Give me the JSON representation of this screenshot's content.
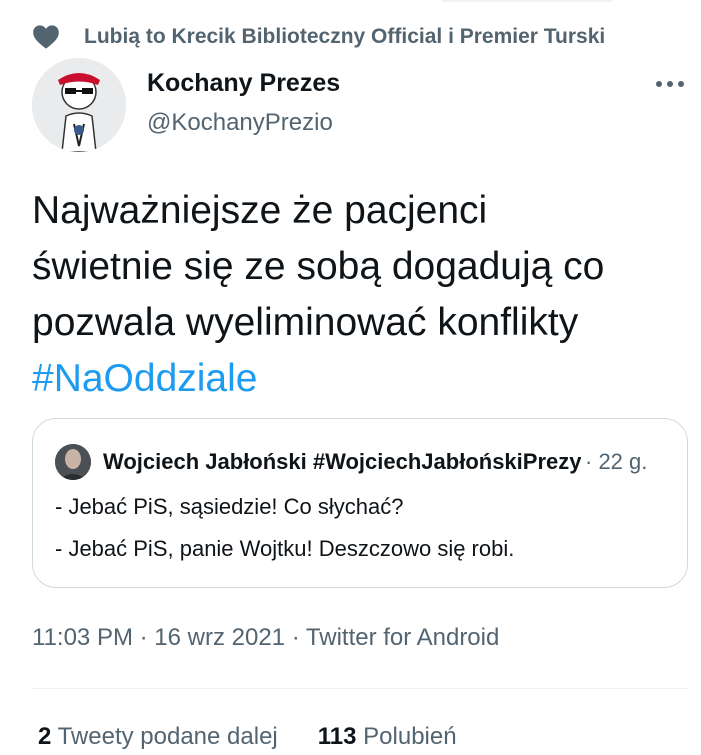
{
  "social_context": {
    "icon": "heart-icon",
    "text": "Lubią to Krecik Biblioteczny Official i Premier Turski"
  },
  "author": {
    "name": "Kochany Prezes",
    "handle": "@KochanyPrezio",
    "avatar": "cartoon-avatar"
  },
  "more_icon": "more-horizontal-icon",
  "tweet": {
    "lines": [
      "Najważniejsze że pacjenci",
      "świetnie się ze sobą dogadują co",
      "pozwala wyeliminować konflikty"
    ],
    "hashtag": "#NaOddziale"
  },
  "quote": {
    "author_name": "Wojciech Jabłoński #WojciechJabłońskiPrezydentem",
    "time": "· 22 g.",
    "lines": [
      "- Jebać PiS, sąsiedzie! Co słychać?",
      "- Jebać PiS, panie Wojtku! Deszczowo się robi."
    ]
  },
  "meta": {
    "text": "11:03 PM · 16 wrz 2021 · Twitter for Android"
  },
  "stats": {
    "retweets_count": "2",
    "retweets_label": "Tweety podane dalej",
    "likes_count": "113",
    "likes_label": "Polubień"
  },
  "colors": {
    "text": "#0f1419",
    "secondary": "#536471",
    "link": "#1d9bf0",
    "border": "#cfd9de"
  }
}
